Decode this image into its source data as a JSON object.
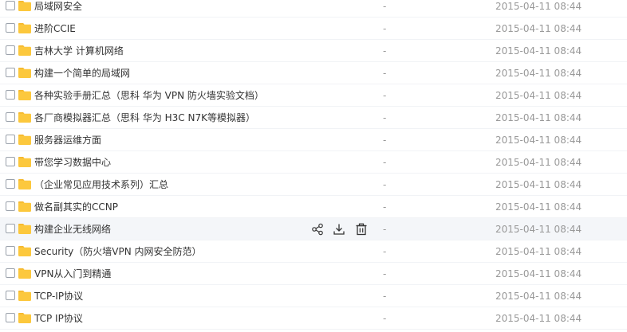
{
  "colors": {
    "folder": "#fcc83d",
    "folder_tab": "#f5b82e",
    "hover_row": "#f4f6f9",
    "icon": "#333333"
  },
  "hover_actions": [
    {
      "icon": "share-icon"
    },
    {
      "icon": "download-icon"
    },
    {
      "icon": "delete-icon"
    }
  ],
  "files": [
    {
      "name": "局域网安全",
      "size": "-",
      "date": "2015-04-11 08:44",
      "hover": false
    },
    {
      "name": "进阶CCIE",
      "size": "-",
      "date": "2015-04-11 08:44",
      "hover": false
    },
    {
      "name": "吉林大学 计算机网络",
      "size": "-",
      "date": "2015-04-11 08:44",
      "hover": false
    },
    {
      "name": "构建一个简单的局域网",
      "size": "-",
      "date": "2015-04-11 08:44",
      "hover": false
    },
    {
      "name": "各种实验手册汇总（思科 华为 VPN 防火墙实验文档）",
      "size": "-",
      "date": "2015-04-11 08:44",
      "hover": false
    },
    {
      "name": "各厂商模拟器汇总（思科 华为 H3C N7K等模拟器）",
      "size": "-",
      "date": "2015-04-11 08:44",
      "hover": false
    },
    {
      "name": "服务器运维方面",
      "size": "-",
      "date": "2015-04-11 08:44",
      "hover": false
    },
    {
      "name": "带您学习数据中心",
      "size": "-",
      "date": "2015-04-11 08:44",
      "hover": false
    },
    {
      "name": "（企业常见应用技术系列）汇总",
      "size": "-",
      "date": "2015-04-11 08:44",
      "hover": false
    },
    {
      "name": "做名副其实的CCNP",
      "size": "-",
      "date": "2015-04-11 08:44",
      "hover": false
    },
    {
      "name": "构建企业无线网络",
      "size": "-",
      "date": "2015-04-11 08:44",
      "hover": true
    },
    {
      "name": "Security（防火墙VPN 内网安全防范）",
      "size": "-",
      "date": "2015-04-11 08:44",
      "hover": false
    },
    {
      "name": "VPN从入门到精通",
      "size": "-",
      "date": "2015-04-11 08:44",
      "hover": false
    },
    {
      "name": "TCP-IP协议",
      "size": "-",
      "date": "2015-04-11 08:44",
      "hover": false
    },
    {
      "name": "TCP IP协议",
      "size": "-",
      "date": "2015-04-11 08:44",
      "hover": false
    }
  ]
}
